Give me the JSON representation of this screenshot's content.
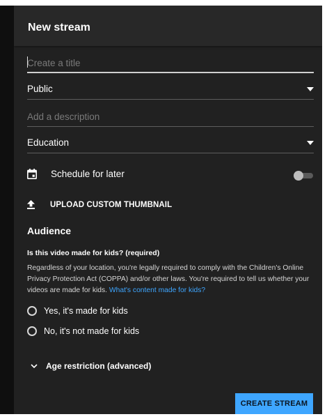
{
  "dialog": {
    "title": "New stream"
  },
  "form": {
    "title_placeholder": "Create a title",
    "visibility": "Public",
    "description_placeholder": "Add a description",
    "category": "Education",
    "schedule_label": "Schedule for later",
    "upload_label": "UPLOAD CUSTOM THUMBNAIL"
  },
  "audience": {
    "title": "Audience",
    "question": "Is this video made for kids? (required)",
    "description": "Regardless of your location, you're legally required to comply with the Children's Online Privacy Protection Act (COPPA) and/or other laws. You're required to tell us whether your videos are made for kids.",
    "link_text": "What's content made for kids?",
    "option_yes": "Yes, it's made for kids",
    "option_no": "No, it's not made for kids"
  },
  "age_restriction_label": "Age restriction (advanced)",
  "create_button": "CREATE STREAM",
  "colors": {
    "dialog_bg": "#212121",
    "header_bg": "#282828",
    "accent": "#3ea6ff"
  }
}
